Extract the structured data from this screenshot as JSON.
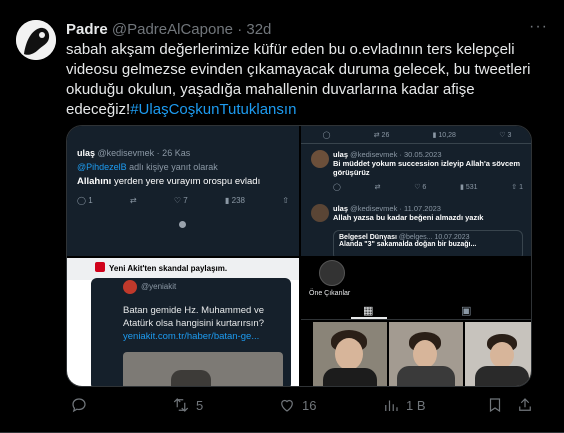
{
  "tweet": {
    "name": "Padre",
    "handle": "@PadreAlCapone",
    "sep": "·",
    "time": "32d",
    "more": "···",
    "text_lines": [
      "sabah akşam değerlerimize küfür eden bu o.evladının ters kelepçeli",
      "videosu gelmezse evinden çıkamayacak duruma gelecek, bu tweetleri",
      "okuduğu okulun, yaşadığa mahallenin duvarlarına kadar afişe"
    ],
    "text_last_prefix": "edeceğiz!",
    "hashtag": "#UlaşCoşkunTutuklansın"
  },
  "media": {
    "cell1": {
      "name": "ulaş",
      "handle": "@kedisevmek · 26 Kas",
      "reply_to_handle": "@PihdezelB",
      "reply_to_suffix": " adlı kişiye yanıt olarak",
      "bold": "Allahını",
      "rest": " yerden yere vurayım orospu evladı",
      "replies": "1",
      "likes": "7",
      "views": "238"
    },
    "cell2": {
      "counts": [
        "26",
        "10,28",
        "3"
      ],
      "post1_name": "ulaş",
      "post1_handle": "@kedisevmek · 30.05.2023",
      "post1_text": "Bi müddet yokum succession izleyip Allah'a sövcem görüşürüz",
      "post1_likes": "6",
      "post1_views": "531",
      "post1_extra": "1",
      "post2_name": "ulaş",
      "post2_handle": "@kedisevmek · 11.07.2023",
      "post2_text": "Allah yazsa bu kadar beğeni almazdı yazık",
      "quote_name": "Belgesel Dünyası",
      "quote_handle": "@belges...",
      "quote_date": "10.07.2023",
      "quote_text": "Alanda \"3\" sakamalda doğan bir buzağı..."
    },
    "cell3": {
      "header": "Yeni Akit'ten skandal paylaşım.",
      "handle": "@yeniakit",
      "text": "Batan gemide Hz. Muhammed ve Atatürk olsa hangisini kurtarırsın?",
      "link": "yeniakit.com.tr/haber/batan-ge..."
    },
    "cell4": {
      "highlight": "Öne Çıkanlar"
    }
  },
  "actions": {
    "replies": "",
    "retweets": "5",
    "likes": "16",
    "views": "1 B"
  }
}
